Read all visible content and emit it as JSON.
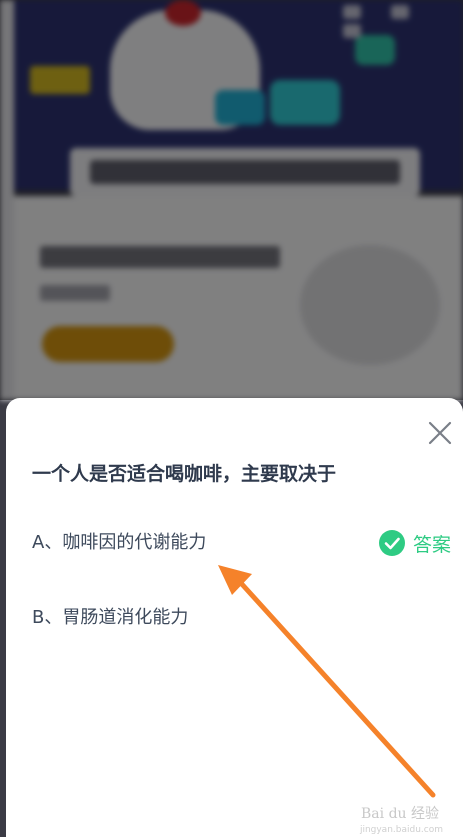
{
  "quiz": {
    "question": "一个人是否适合喝咖啡，主要取决于",
    "options": [
      {
        "label": "A、咖啡因的代谢能力"
      },
      {
        "label": "B、胃肠道消化能力"
      }
    ],
    "answer_label": "答案",
    "close_icon": "close-icon",
    "check_icon": "check-circle-icon"
  },
  "colors": {
    "accent_green": "#2ecb83",
    "arrow_orange": "#f5822a",
    "question_text": "#2f3a4d"
  },
  "watermark": {
    "text": "Bai du 经验",
    "sub": "jingyan.baidu.com"
  }
}
